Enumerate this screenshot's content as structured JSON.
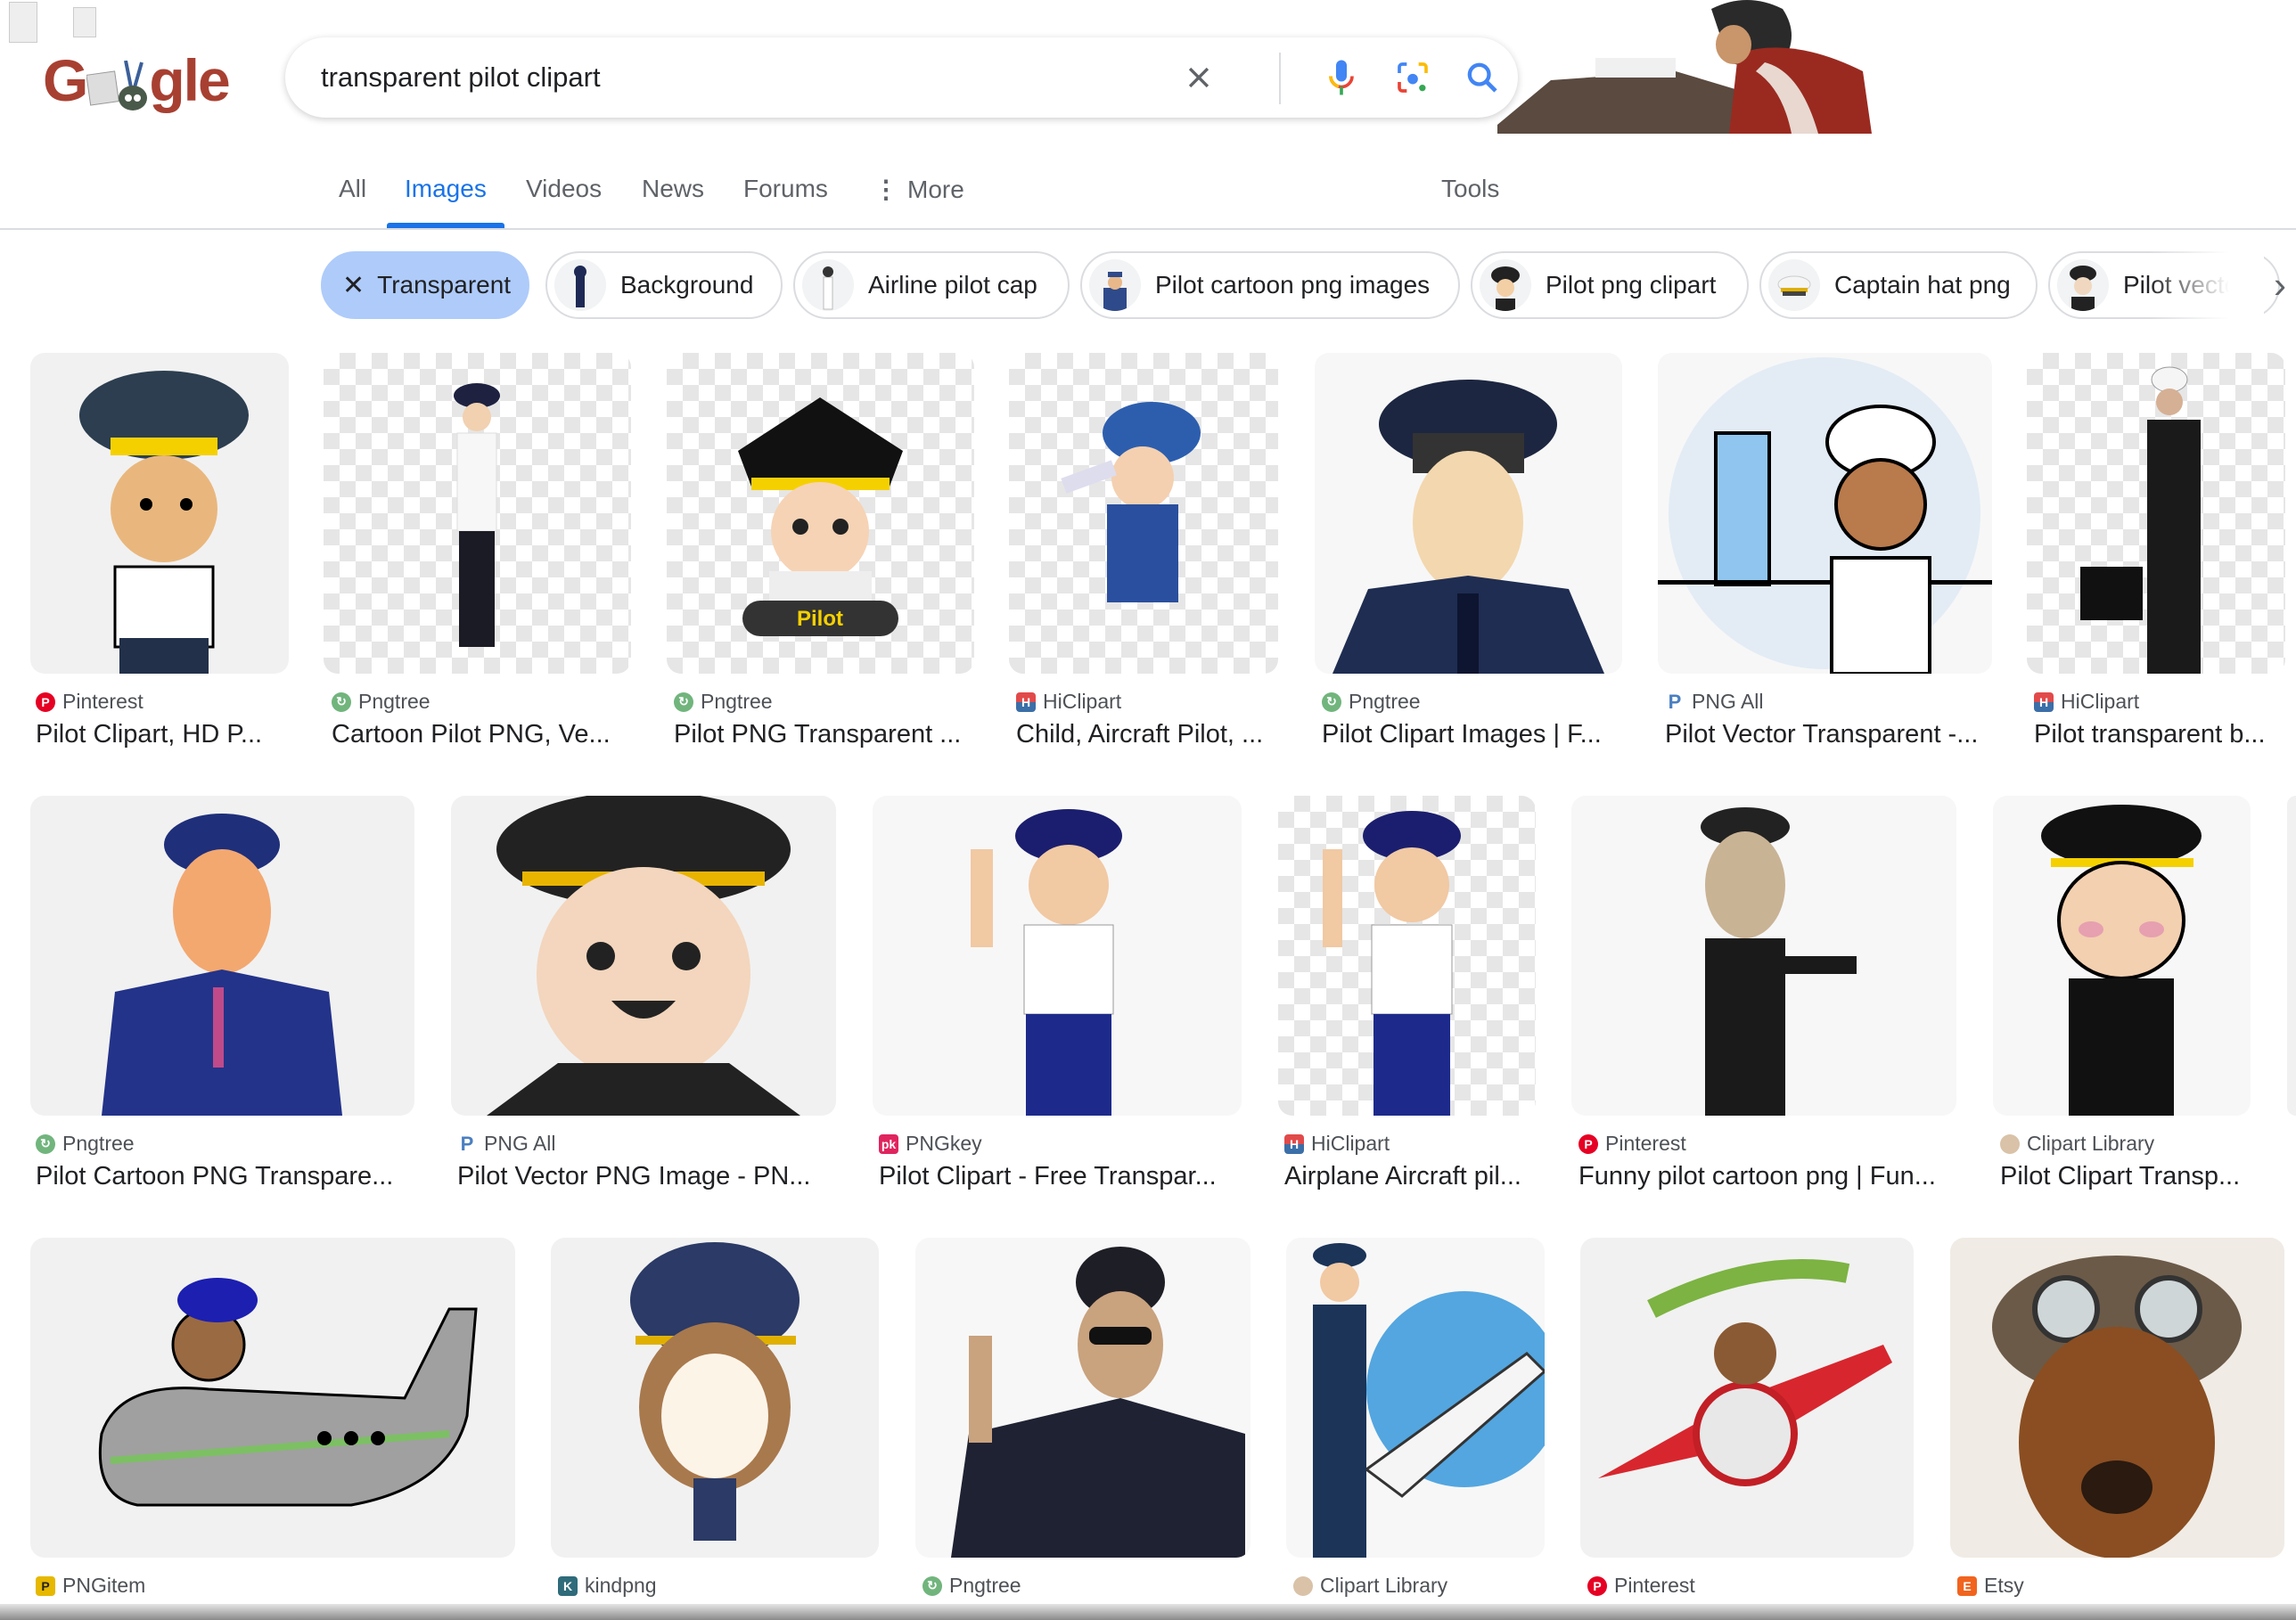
{
  "search": {
    "query": "transparent pilot clipart",
    "logo_text": "G  gle"
  },
  "tabs": [
    {
      "label": "All",
      "active": false
    },
    {
      "label": "Images",
      "active": true
    },
    {
      "label": "Videos",
      "active": false
    },
    {
      "label": "News",
      "active": false
    },
    {
      "label": "Forums",
      "active": false
    },
    {
      "label": "More",
      "active": false
    }
  ],
  "tools_label": "Tools",
  "chips": [
    {
      "label": "Transparent",
      "selected": true
    },
    {
      "label": "Background",
      "selected": false
    },
    {
      "label": "Airline pilot cap",
      "selected": false
    },
    {
      "label": "Pilot cartoon png images",
      "selected": false
    },
    {
      "label": "Pilot png clipart",
      "selected": false
    },
    {
      "label": "Captain hat png",
      "selected": false
    },
    {
      "label": "Pilot vecto",
      "selected": false
    }
  ],
  "results": [
    {
      "source": "Pinterest",
      "title": "Pilot Clipart, HD P..."
    },
    {
      "source": "Pngtree",
      "title": "Cartoon Pilot PNG, Ve..."
    },
    {
      "source": "Pngtree",
      "title": "Pilot PNG Transparent ..."
    },
    {
      "source": "HiClipart",
      "title": "Child, Aircraft Pilot, ..."
    },
    {
      "source": "Pngtree",
      "title": "Pilot Clipart Images | F..."
    },
    {
      "source": "PNG All",
      "title": "Pilot Vector Transparent -..."
    },
    {
      "source": "HiClipart",
      "title": "Pilot transparent b..."
    },
    {
      "source": "Pngtree",
      "title": "Pilot Cartoon PNG Transpare..."
    },
    {
      "source": "PNG All",
      "title": "Pilot Vector PNG Image - PN..."
    },
    {
      "source": "PNGkey",
      "title": "Pilot Clipart - Free Transpar..."
    },
    {
      "source": "HiClipart",
      "title": "Airplane Aircraft pil..."
    },
    {
      "source": "Pinterest",
      "title": "Funny pilot cartoon png | Fun..."
    },
    {
      "source": "Clipart Library",
      "title": "Pilot Clipart Transp..."
    },
    {
      "source": "PNGitem",
      "title": ""
    },
    {
      "source": "kindpng",
      "title": ""
    },
    {
      "source": "Pngtree",
      "title": ""
    },
    {
      "source": "Clipart Library",
      "title": ""
    },
    {
      "source": "Pinterest",
      "title": ""
    },
    {
      "source": "Etsy",
      "title": ""
    }
  ],
  "colors": {
    "accent": "#1a73e8",
    "selected_chip": "#aecbfa",
    "logo": "#a84032"
  }
}
